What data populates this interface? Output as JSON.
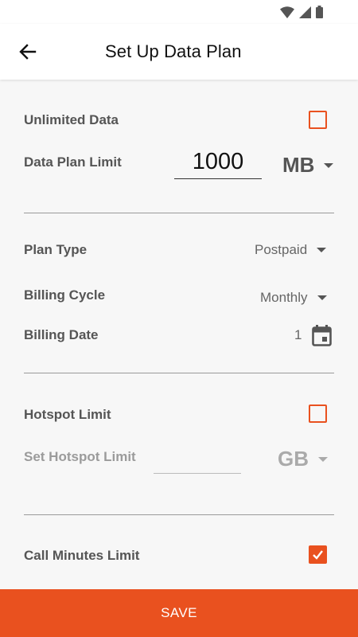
{
  "app_bar": {
    "title": "Set Up Data Plan",
    "back_icon": "arrow-left-icon"
  },
  "status_bar": {
    "icons": [
      "wifi-icon",
      "cell-signal-icon",
      "battery-icon"
    ]
  },
  "data_section": {
    "unlimited_label": "Unlimited Data",
    "unlimited_checked": false,
    "limit_label": "Data Plan Limit",
    "limit_value": "1000",
    "limit_unit": "MB"
  },
  "plan_section": {
    "plan_type_label": "Plan Type",
    "plan_type_value": "Postpaid",
    "billing_cycle_label": "Billing Cycle",
    "billing_cycle_value": "Monthly",
    "billing_date_label": "Billing Date",
    "billing_date_value": "1",
    "calendar_icon": "calendar-icon"
  },
  "hotspot_section": {
    "hotspot_label": "Hotspot Limit",
    "hotspot_checked": false,
    "set_hotspot_label": "Set Hotspot Limit",
    "set_hotspot_value": "",
    "hotspot_unit": "GB"
  },
  "calls_section": {
    "call_minutes_label": "Call Minutes Limit",
    "call_minutes_checked": true
  },
  "footer": {
    "save_label": "SAVE"
  },
  "colors": {
    "accent": "#e9511f",
    "background": "#f7f7f7",
    "app_bar": "#ffffff"
  }
}
